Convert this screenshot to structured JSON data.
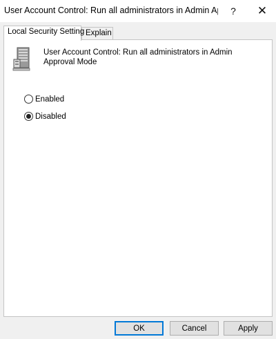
{
  "window": {
    "title": "User Account Control: Run all administrators in Admin Ap...",
    "help_label": "?",
    "close_label": "✕"
  },
  "tabs": [
    {
      "label": "Local Security Setting",
      "active": true
    },
    {
      "label": "Explain",
      "active": false
    }
  ],
  "policy": {
    "icon": "server-computer-icon",
    "title": "User Account Control: Run all administrators in Admin Approval Mode"
  },
  "options": [
    {
      "label": "Enabled",
      "selected": false
    },
    {
      "label": "Disabled",
      "selected": true
    }
  ],
  "buttons": {
    "ok_label": "OK",
    "cancel_label": "Cancel",
    "apply_label": "Apply"
  },
  "colors": {
    "accent": "#0078d7",
    "background": "#f0f0f0"
  }
}
